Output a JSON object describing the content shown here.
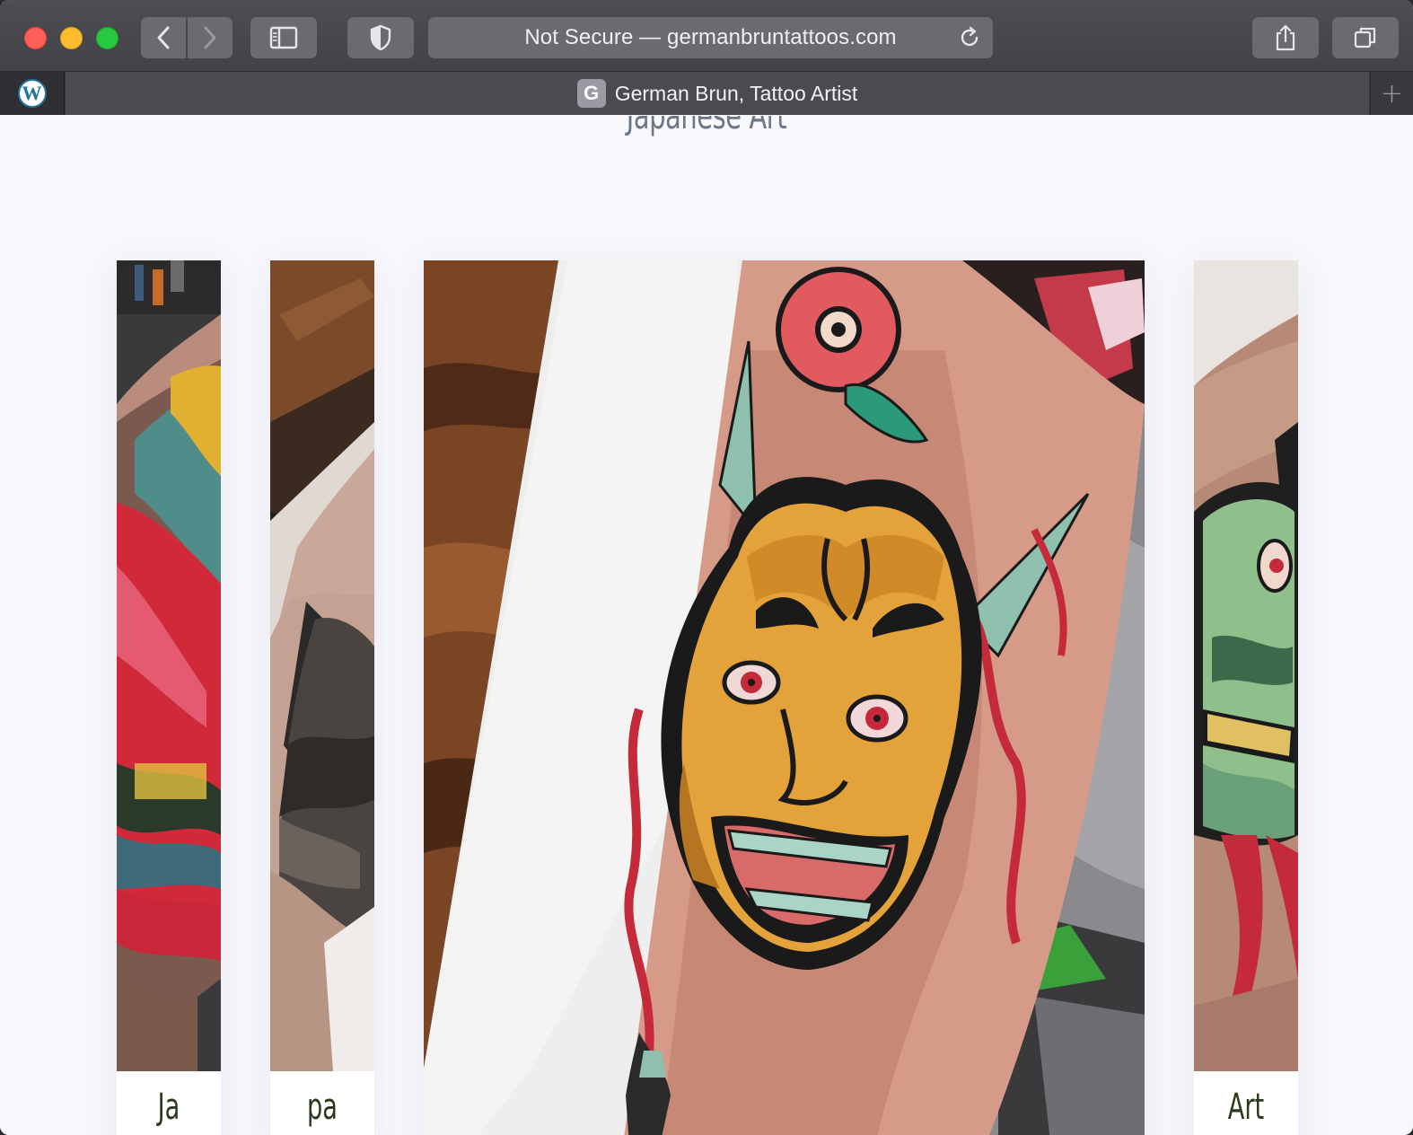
{
  "browser": {
    "address": "Not Secure — germanbruntattoos.com",
    "tab_title": "German Brun, Tattoo Artist",
    "favicon_letter": "G",
    "pinned_tab_logo": "W",
    "new_tab": "+"
  },
  "icons": {
    "back": "chevron-left-icon",
    "forward": "chevron-right-icon",
    "sidebar": "sidebar-icon",
    "privacy": "shield-icon",
    "reload": "reload-icon",
    "share": "share-icon",
    "tabs": "tabs-overview-icon"
  },
  "page": {
    "section_title": "Japanese Art",
    "cards": [
      {
        "caption": "Ja"
      },
      {
        "caption": "pa"
      },
      {
        "caption": ""
      },
      {
        "caption": "Art"
      }
    ]
  }
}
